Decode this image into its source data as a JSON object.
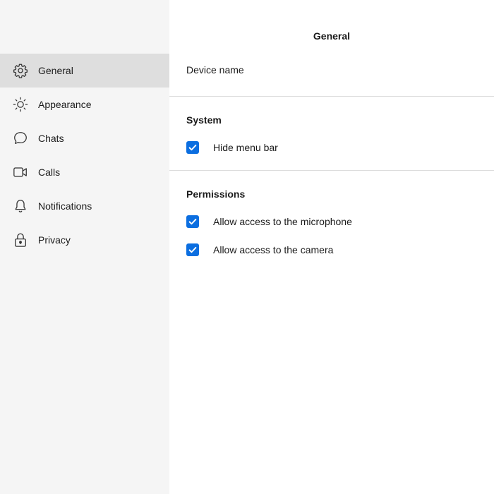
{
  "sidebar": {
    "items": [
      {
        "label": "General",
        "icon": "gear-icon",
        "active": true
      },
      {
        "label": "Appearance",
        "icon": "sun-icon",
        "active": false
      },
      {
        "label": "Chats",
        "icon": "chat-bubble-icon",
        "active": false
      },
      {
        "label": "Calls",
        "icon": "video-camera-icon",
        "active": false
      },
      {
        "label": "Notifications",
        "icon": "bell-icon",
        "active": false
      },
      {
        "label": "Privacy",
        "icon": "lock-icon",
        "active": false
      }
    ]
  },
  "main": {
    "title": "General",
    "device_name_label": "Device name",
    "sections": [
      {
        "title": "System",
        "options": [
          {
            "label": "Hide menu bar",
            "checked": true
          }
        ]
      },
      {
        "title": "Permissions",
        "options": [
          {
            "label": "Allow access to the microphone",
            "checked": true
          },
          {
            "label": "Allow access to the camera",
            "checked": true
          }
        ]
      }
    ]
  },
  "colors": {
    "sidebar_bg": "#f5f5f5",
    "active_item_bg": "#dedede",
    "accent": "#0b6ee0",
    "divider": "#dcdcdc"
  }
}
